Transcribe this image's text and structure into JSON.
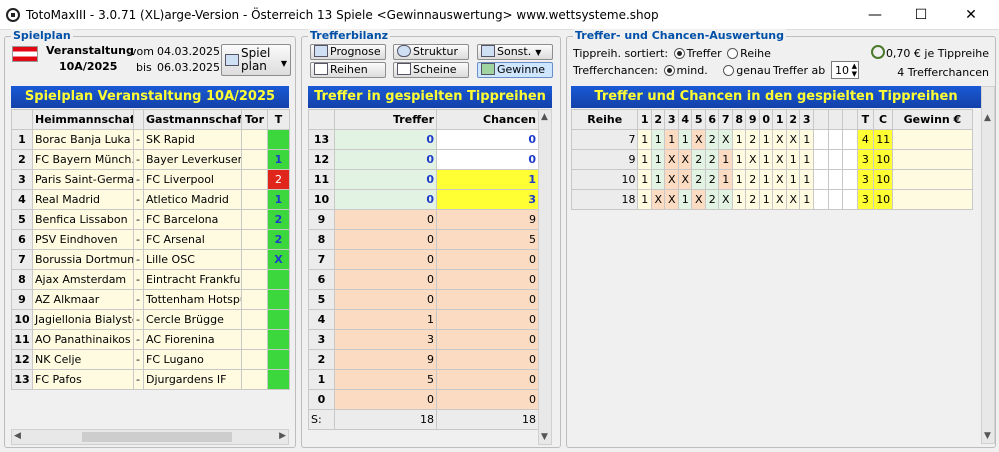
{
  "window": {
    "title": "TotoMaxIII - 3.0.71 (XL)arge-Version - Österreich 13 Spiele     <Gewinnauswertung>     www.wettsysteme.shop",
    "minimize": "—",
    "maximize": "☐",
    "close": "✕"
  },
  "spielplan": {
    "group_title": "Spielplan",
    "veranstaltung_label": "Veranstaltung",
    "veranstaltung_value": "10A/2025",
    "vom_label": "vom",
    "vom_value": "04.03.2025",
    "bis_label": "bis",
    "bis_value": "06.03.2025",
    "button_label": "Spiel plan",
    "header": "Spielplan Veranstaltung 10A/2025",
    "cols": {
      "home": "Heimmannschaft",
      "away": "Gastmannschaft",
      "tor": "Tor",
      "t": "T"
    },
    "matches": [
      {
        "n": "1",
        "home": "Borac Banja Luka",
        "sep": "-",
        "away": "SK Rapid",
        "t": ""
      },
      {
        "n": "2",
        "home": "FC Bayern Münch...",
        "sep": "-",
        "away": "Bayer Leverkusen",
        "t": "1"
      },
      {
        "n": "3",
        "home": "Paris Saint-Germain",
        "sep": "-",
        "away": "FC Liverpool",
        "t": "2"
      },
      {
        "n": "4",
        "home": "Real Madrid",
        "sep": "-",
        "away": "Atletico Madrid",
        "t": "1"
      },
      {
        "n": "5",
        "home": "Benfica Lissabon",
        "sep": "-",
        "away": "FC Barcelona",
        "t": "2"
      },
      {
        "n": "6",
        "home": "PSV Eindhoven",
        "sep": "-",
        "away": "FC Arsenal",
        "t": "2"
      },
      {
        "n": "7",
        "home": "Borussia Dortmund",
        "sep": "-",
        "away": "Lille OSC",
        "t": "X"
      },
      {
        "n": "8",
        "home": "Ajax Amsterdam",
        "sep": "-",
        "away": "Eintracht Frankfurt",
        "t": ""
      },
      {
        "n": "9",
        "home": "AZ Alkmaar",
        "sep": "-",
        "away": "Tottenham Hotspur",
        "t": ""
      },
      {
        "n": "10",
        "home": "Jagiellonia Bialystok",
        "sep": "-",
        "away": "Cercle Brügge",
        "t": ""
      },
      {
        "n": "11",
        "home": "AO Panathinaikos",
        "sep": "-",
        "away": "AC Fiorenina",
        "t": ""
      },
      {
        "n": "12",
        "home": "NK Celje",
        "sep": "-",
        "away": "FC Lugano",
        "t": ""
      },
      {
        "n": "13",
        "home": "FC Pafos",
        "sep": "-",
        "away": "Djurgardens IF",
        "t": ""
      }
    ]
  },
  "trefferbilanz": {
    "group_title": "Trefferbilanz",
    "buttons": {
      "prognose": "Prognose",
      "struktur": "Struktur",
      "sonst": "Sonst.",
      "reihen": "Reihen",
      "scheine": "Scheine",
      "gewinne": "Gewinne"
    },
    "header": "Treffer in gespielten Tippreihen",
    "cols": {
      "treffer": "Treffer",
      "chancen": "Chancen"
    },
    "rows": [
      {
        "k": "13",
        "treffer": "0",
        "chancen": "0"
      },
      {
        "k": "12",
        "treffer": "0",
        "chancen": "0"
      },
      {
        "k": "11",
        "treffer": "0",
        "chancen": "1"
      },
      {
        "k": "10",
        "treffer": "0",
        "chancen": "3"
      },
      {
        "k": "9",
        "treffer": "0",
        "chancen": "9"
      },
      {
        "k": "8",
        "treffer": "0",
        "chancen": "5"
      },
      {
        "k": "7",
        "treffer": "0",
        "chancen": "0"
      },
      {
        "k": "6",
        "treffer": "0",
        "chancen": "0"
      },
      {
        "k": "5",
        "treffer": "0",
        "chancen": "0"
      },
      {
        "k": "4",
        "treffer": "1",
        "chancen": "0"
      },
      {
        "k": "3",
        "treffer": "3",
        "chancen": "0"
      },
      {
        "k": "2",
        "treffer": "9",
        "chancen": "0"
      },
      {
        "k": "1",
        "treffer": "5",
        "chancen": "0"
      },
      {
        "k": "0",
        "treffer": "0",
        "chancen": "0"
      }
    ],
    "sum_label": "S:",
    "sum_treffer": "18",
    "sum_chancen": "18"
  },
  "auswertung": {
    "group_title": "Treffer- und Chancen-Auswertung",
    "sort_label": "Tippreih. sortiert:",
    "sort_opt1": "Treffer",
    "sort_opt2": "Reihe",
    "chance_label": "Trefferchancen:",
    "chance_opt1": "mind.",
    "chance_opt2": "genau",
    "treffer_ab_label": "Treffer ab",
    "treffer_ab_value": "10",
    "info1": "0,70 € je Tippreihe",
    "info2": "4 Trefferchancen",
    "header": "Treffer und Chancen in den gespielten Tippreihen",
    "cols": {
      "reihe": "Reihe",
      "games": [
        "1",
        "2",
        "3",
        "4",
        "5",
        "6",
        "7",
        "8",
        "9",
        "0",
        "1",
        "2",
        "3"
      ],
      "t": "T",
      "c": "C",
      "gewinn": "Gewinn €"
    },
    "rows": [
      {
        "reihe": "7",
        "tips": [
          "1",
          "1",
          "1",
          "1",
          "X",
          "2",
          "X",
          "1",
          "2",
          "1",
          "X",
          "X",
          "1"
        ],
        "t": "4",
        "c": "11",
        "gewinn": ""
      },
      {
        "reihe": "9",
        "tips": [
          "1",
          "1",
          "X",
          "X",
          "2",
          "2",
          "1",
          "1",
          "X",
          "1",
          "X",
          "1",
          "1"
        ],
        "t": "3",
        "c": "10",
        "gewinn": ""
      },
      {
        "reihe": "10",
        "tips": [
          "1",
          "1",
          "X",
          "X",
          "2",
          "2",
          "1",
          "1",
          "2",
          "1",
          "X",
          "1",
          "1"
        ],
        "t": "3",
        "c": "10",
        "gewinn": ""
      },
      {
        "reihe": "18",
        "tips": [
          "1",
          "X",
          "X",
          "1",
          "X",
          "2",
          "X",
          "1",
          "2",
          "1",
          "X",
          "X",
          "1"
        ],
        "t": "3",
        "c": "10",
        "gewinn": ""
      }
    ]
  },
  "colors": {
    "header_bg": "#1a4fc4",
    "header_text": "#ffff33",
    "hit_green": "#3cd73c",
    "miss_red": "#e0261a",
    "chance_yellow": "#ffff33"
  }
}
